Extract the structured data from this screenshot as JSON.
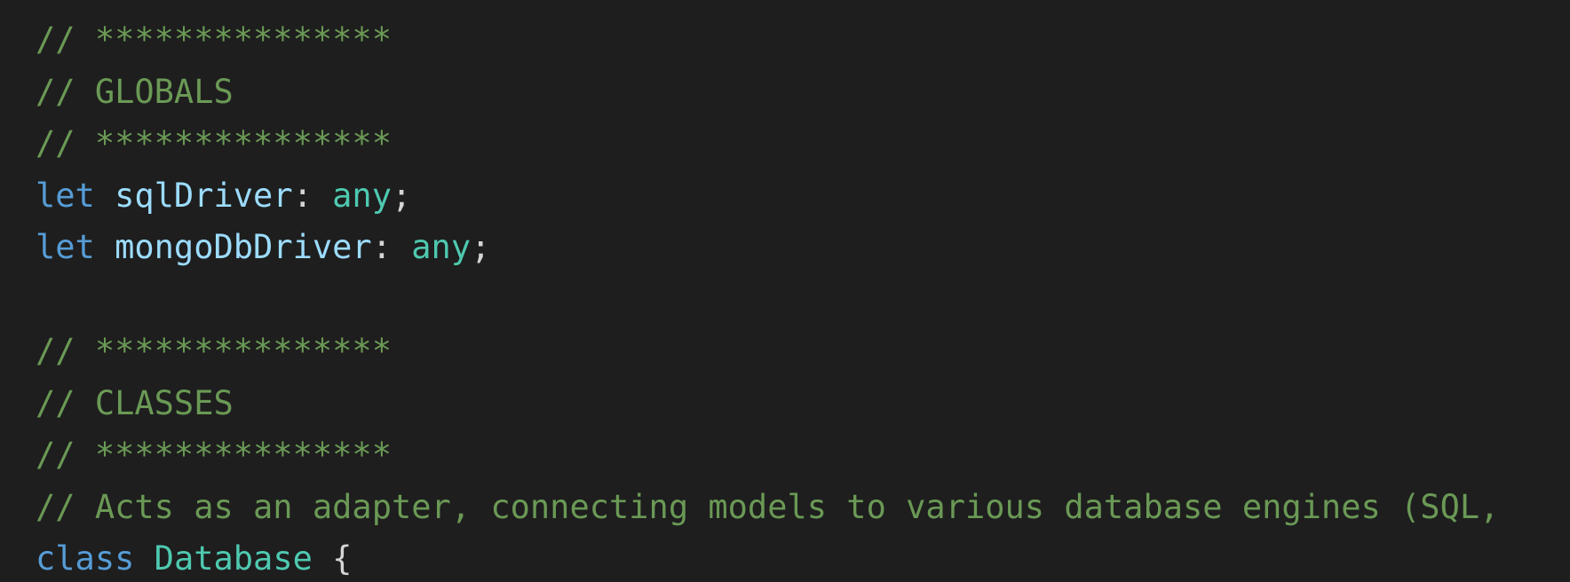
{
  "editor": {
    "lines": [
      {
        "tokens": [
          {
            "kind": "comment",
            "text": "// ***************"
          }
        ]
      },
      {
        "tokens": [
          {
            "kind": "comment",
            "text": "// GLOBALS"
          }
        ]
      },
      {
        "tokens": [
          {
            "kind": "comment",
            "text": "// ***************"
          }
        ]
      },
      {
        "tokens": [
          {
            "kind": "keyword",
            "text": "let"
          },
          {
            "kind": "punct",
            "text": " "
          },
          {
            "kind": "variable",
            "text": "sqlDriver"
          },
          {
            "kind": "punct",
            "text": ": "
          },
          {
            "kind": "type",
            "text": "any"
          },
          {
            "kind": "punct",
            "text": ";"
          }
        ]
      },
      {
        "tokens": [
          {
            "kind": "keyword",
            "text": "let"
          },
          {
            "kind": "punct",
            "text": " "
          },
          {
            "kind": "variable",
            "text": "mongoDbDriver"
          },
          {
            "kind": "punct",
            "text": ": "
          },
          {
            "kind": "type",
            "text": "any"
          },
          {
            "kind": "punct",
            "text": ";"
          }
        ]
      },
      {
        "tokens": []
      },
      {
        "tokens": [
          {
            "kind": "comment",
            "text": "// ***************"
          }
        ]
      },
      {
        "tokens": [
          {
            "kind": "comment",
            "text": "// CLASSES"
          }
        ]
      },
      {
        "tokens": [
          {
            "kind": "comment",
            "text": "// ***************"
          }
        ]
      },
      {
        "tokens": [
          {
            "kind": "comment",
            "text": "// Acts as an adapter, connecting models to various database engines (SQL,"
          }
        ]
      },
      {
        "tokens": [
          {
            "kind": "keyword",
            "text": "class"
          },
          {
            "kind": "punct",
            "text": " "
          },
          {
            "kind": "type",
            "text": "Database"
          },
          {
            "kind": "punct",
            "text": " {"
          }
        ]
      }
    ]
  }
}
